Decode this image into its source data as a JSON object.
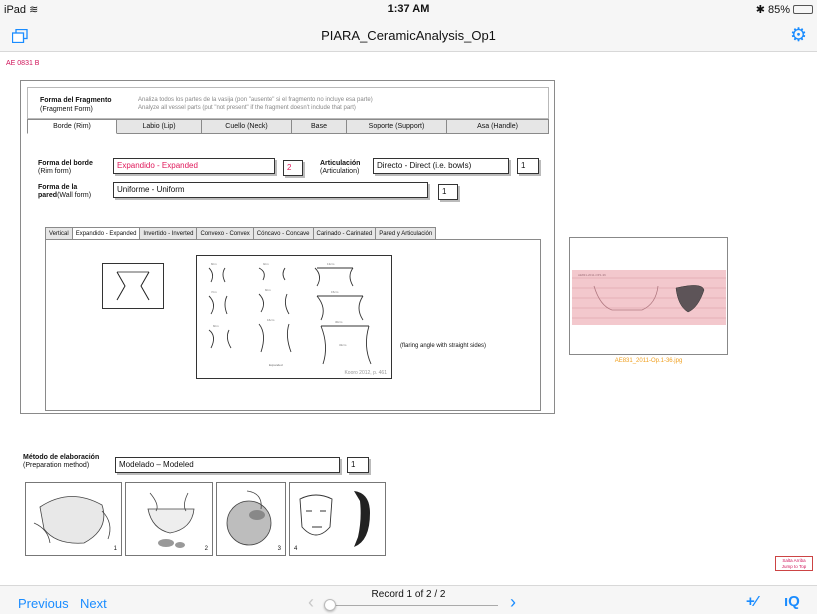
{
  "status": {
    "device": "iPad",
    "time": "1:37 AM",
    "battery": "85%"
  },
  "nav": {
    "title": "PIARA_CeramicAnalysis_Op1"
  },
  "record_id": "AE 0831 B",
  "fragment": {
    "label_es": "Forma del Fragmento",
    "label_en": "(Fragment Form)",
    "help_es": "Analiza todos los partes de la vasija (pon \"ausente\" si el fragmento no incluye esa parte)",
    "help_en": "Analyze all vessel parts (put \"not present\" if the fragment doesn't include that part)"
  },
  "tabs": [
    "Borde (Rim)",
    "Labio (Lip)",
    "Cuello (Neck)",
    "Base",
    "Soporte (Support)",
    "Asa (Handle)"
  ],
  "rim_form": {
    "label_es": "Forma del borde",
    "label_en": "(Rim form)",
    "value": "Expandido - Expanded",
    "code": "2"
  },
  "articulation": {
    "label_es": "Articulación",
    "label_en": "(Articulation)",
    "value": "Directo - Direct (i.e. bowls)",
    "code": "1"
  },
  "wall_form": {
    "label_es": "Forma de la",
    "label_es2": "pared",
    "label_en": "(Wall form)",
    "value": "Uniforme - Uniform",
    "code": "1"
  },
  "subtabs": [
    "Vertical",
    "Expandido - Expanded",
    "Invertido - Inverted",
    "Convexo - Convex",
    "Cóncavo - Concave",
    "Carinado - Carinated",
    "Pared y Articulación"
  ],
  "reference": {
    "caption": "Kooro 2012, p. 461",
    "note": "(flaring angle with straight sides)"
  },
  "photo": {
    "caption": "AE831_2011-Op.1-36.jpg"
  },
  "elaboration": {
    "label_es": "Método de elaboración",
    "label_en": "(Preparation method)",
    "value": "Modelado – Modeled",
    "code": "1",
    "figure_numbers": [
      "1",
      "2",
      "3",
      "4"
    ]
  },
  "jump": {
    "line1": "Salta Arriba",
    "line2": "Jump to Top"
  },
  "bottom": {
    "previous": "Previous",
    "next": "Next",
    "record": "Record 1 of 2 / 2",
    "record_position": 0.0
  },
  "colors": {
    "accent": "#1a8cff",
    "record_red": "#e0185a",
    "caption_orange": "#f0a020"
  }
}
